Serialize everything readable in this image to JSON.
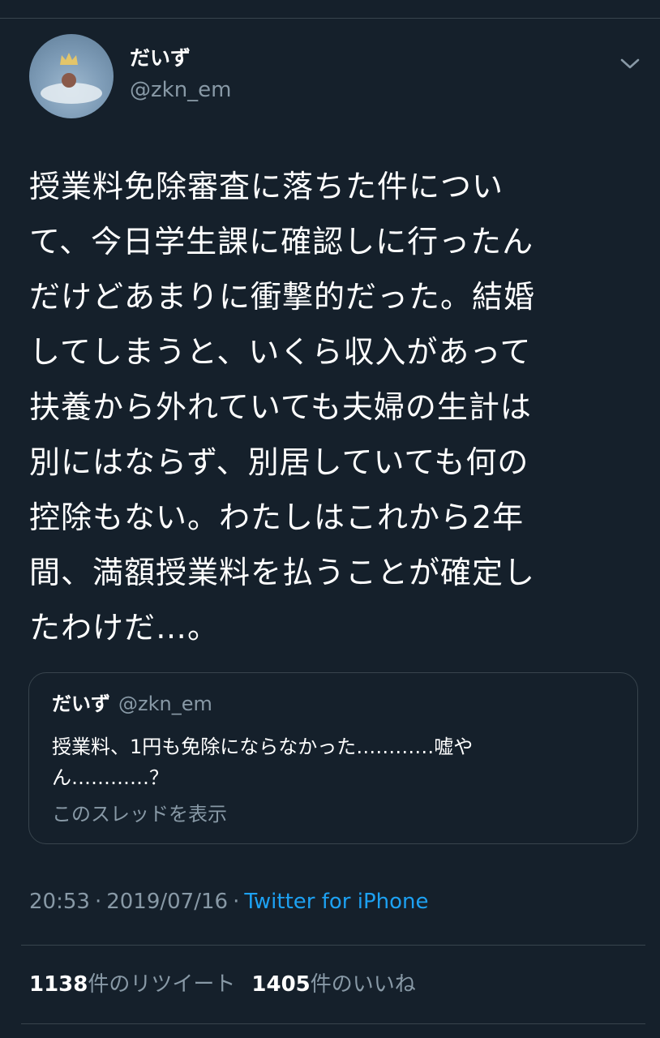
{
  "author": {
    "display_name": "だいず",
    "handle": "@zkn_em",
    "avatar_icon": "avatar-image"
  },
  "tweet": {
    "lines": [
      "授業料免除審査に落ちた件につい",
      "て、今日学生課に確認しに行ったん",
      "だけどあまりに衝撃的だった。結婚",
      "してしまうと、いくら収入があって",
      "扶養から外れていても夫婦の生計は",
      "別にはならず、別居していても何の",
      "控除もない。わたしはこれから2年",
      "間、満額授業料を払うことが確定し",
      "たわけだ…。"
    ]
  },
  "quoted_tweet": {
    "display_name": "だいず",
    "handle": "@zkn_em",
    "lines": [
      "授業料、1円も免除にならなかった…………嘘や",
      "ん…………？"
    ],
    "show_thread_label": "このスレッドを表示"
  },
  "meta": {
    "time": "20:53",
    "date": "2019/07/16",
    "client": "Twitter for iPhone",
    "separator": "·"
  },
  "stats": {
    "retweets_count": "1138",
    "retweets_label": "件のリツイート",
    "likes_count": "1405",
    "likes_label": "件のいいね"
  },
  "colors": {
    "background": "#15202b",
    "text_primary": "#ffffff",
    "text_secondary": "#8899a6",
    "link": "#1da1f2",
    "border": "#38444d"
  }
}
